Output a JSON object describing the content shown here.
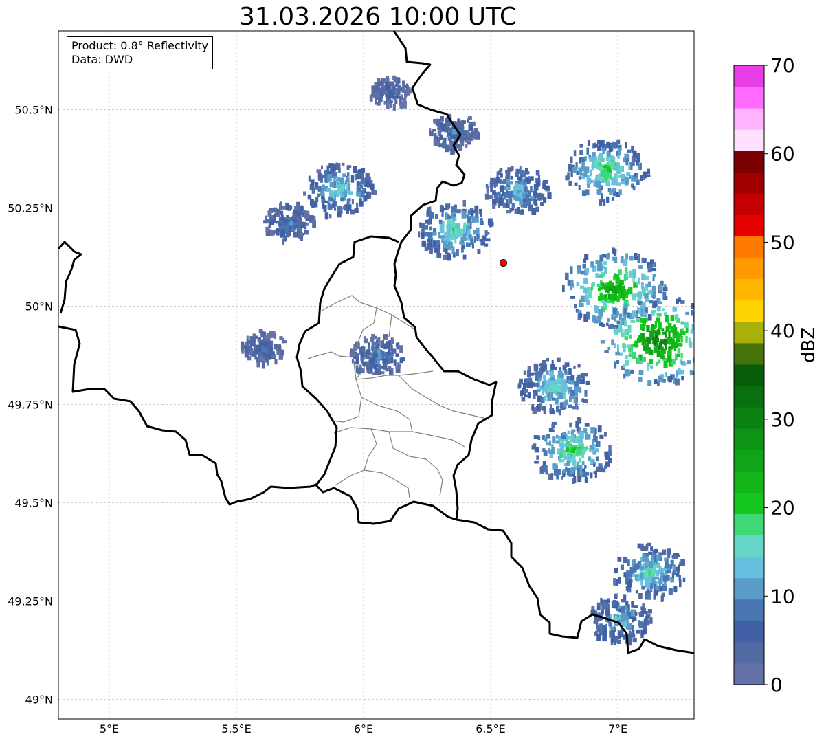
{
  "title": "31.03.2026 10:00 UTC",
  "info_box": {
    "product": "Product: 0.8° Reflectivity",
    "source": "Data: DWD"
  },
  "map": {
    "lon_range": [
      4.8,
      7.3
    ],
    "lat_range": [
      48.95,
      50.7
    ],
    "lon_ticks": [
      {
        "value": 5.0,
        "label": "5°E"
      },
      {
        "value": 5.5,
        "label": "5.5°E"
      },
      {
        "value": 6.0,
        "label": "6°E"
      },
      {
        "value": 6.5,
        "label": "6.5°E"
      },
      {
        "value": 7.0,
        "label": "7°E"
      }
    ],
    "lat_ticks": [
      {
        "value": 50.5,
        "label": "50.5°N"
      },
      {
        "value": 50.25,
        "label": "50.25°N"
      },
      {
        "value": 50.0,
        "label": "50°N"
      },
      {
        "value": 49.75,
        "label": "49.75°N"
      },
      {
        "value": 49.5,
        "label": "49.5°N"
      },
      {
        "value": 49.25,
        "label": "49.25°N"
      },
      {
        "value": 49.0,
        "label": "49°N"
      }
    ],
    "radar_site": {
      "lon": 6.55,
      "lat": 50.11,
      "color": "#ff0000"
    },
    "echoes": [
      {
        "lon": 5.9,
        "lat": 50.3,
        "dbz": 14
      },
      {
        "lon": 5.7,
        "lat": 50.22,
        "dbz": 8
      },
      {
        "lon": 5.6,
        "lat": 49.9,
        "dbz": 6
      },
      {
        "lon": 6.35,
        "lat": 50.2,
        "dbz": 16
      },
      {
        "lon": 6.1,
        "lat": 50.55,
        "dbz": 5
      },
      {
        "lon": 6.35,
        "lat": 50.45,
        "dbz": 7
      },
      {
        "lon": 6.6,
        "lat": 50.3,
        "dbz": 12
      },
      {
        "lon": 6.95,
        "lat": 50.35,
        "dbz": 18
      },
      {
        "lon": 6.98,
        "lat": 50.05,
        "dbz": 24
      },
      {
        "lon": 7.15,
        "lat": 49.92,
        "dbz": 28
      },
      {
        "lon": 6.75,
        "lat": 49.8,
        "dbz": 15
      },
      {
        "lon": 6.82,
        "lat": 49.64,
        "dbz": 18
      },
      {
        "lon": 7.12,
        "lat": 49.33,
        "dbz": 15
      },
      {
        "lon": 7.0,
        "lat": 49.21,
        "dbz": 12
      },
      {
        "lon": 6.05,
        "lat": 49.88,
        "dbz": 9
      }
    ]
  },
  "colorbar": {
    "label": "dBZ",
    "vmin": 0,
    "vmax": 70,
    "ticks": [
      {
        "value": 0,
        "label": "0"
      },
      {
        "value": 10,
        "label": "10"
      },
      {
        "value": 20,
        "label": "20"
      },
      {
        "value": 30,
        "label": "30"
      },
      {
        "value": 40,
        "label": "40"
      },
      {
        "value": 50,
        "label": "50"
      },
      {
        "value": 60,
        "label": "60"
      },
      {
        "value": 70,
        "label": "70"
      }
    ],
    "colors": [
      "#6472a8",
      "#5369a2",
      "#4260a6",
      "#4a77b2",
      "#5a9cc8",
      "#67c0e0",
      "#65d6c5",
      "#3ed877",
      "#13c71c",
      "#12b51a",
      "#10a516",
      "#0e9414",
      "#0c8212",
      "#0a700f",
      "#075d0b",
      "#45740b",
      "#a8b00a",
      "#ffd400",
      "#ffb600",
      "#ff9a00",
      "#ff7b00",
      "#e60000",
      "#c50000",
      "#a00000",
      "#7b0000",
      "#ffe0ff",
      "#ffb3ff",
      "#ff6bff",
      "#e83ee8"
    ]
  }
}
